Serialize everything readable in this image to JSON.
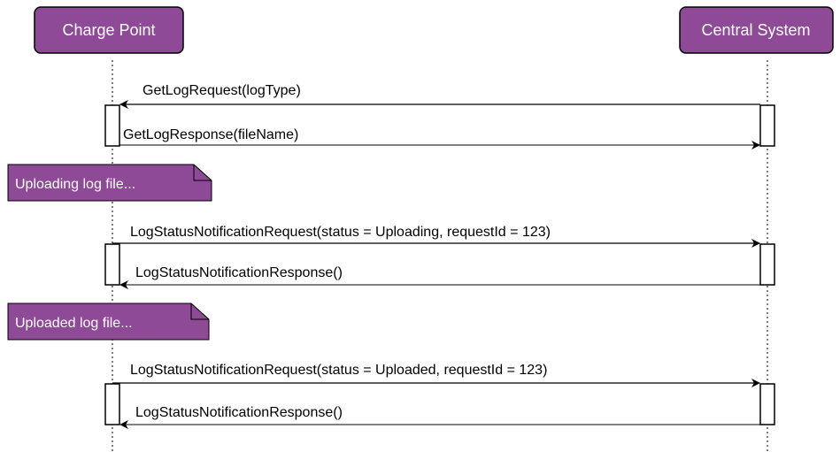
{
  "participants": {
    "left": "Charge Point",
    "right": "Central System"
  },
  "messages": [
    {
      "label": "GetLogRequest(logType)",
      "direction": "to-left"
    },
    {
      "label": "GetLogResponse(fileName)",
      "direction": "to-right"
    },
    {
      "label": "LogStatusNotificationRequest(status = Uploading, requestId = 123)",
      "direction": "to-right"
    },
    {
      "label": "LogStatusNotificationResponse()",
      "direction": "to-left"
    },
    {
      "label": "LogStatusNotificationRequest(status = Uploaded, requestId = 123)",
      "direction": "to-right"
    },
    {
      "label": "LogStatusNotificationResponse()",
      "direction": "to-left"
    }
  ],
  "notes": [
    "Uploading log file...",
    "Uploaded log file..."
  ],
  "colors": {
    "participant_fill": "#8e4a96",
    "note_fill": "#8e4a96",
    "line": "#000000"
  }
}
